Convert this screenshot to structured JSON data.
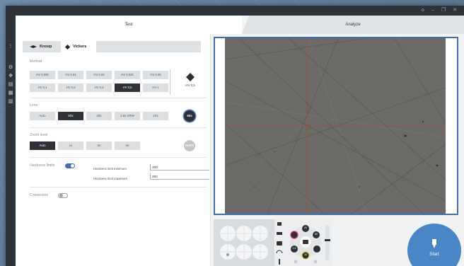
{
  "window": {
    "controls": [
      "ᴑ",
      "–",
      "❐",
      "✕"
    ]
  },
  "tabs": {
    "test": "Test",
    "analyze": "Analyze"
  },
  "method_tabs": {
    "knoop": "Knoop",
    "vickers": "Vickers"
  },
  "method": {
    "label": "Method",
    "buttons": [
      "HV 0,005",
      "HV 0,01",
      "HV 0,02",
      "HV 0,025",
      "HV 0,05",
      "HV 0,1",
      "HV 0,2",
      "HV 0,3",
      "HV 0,5",
      "HV 1"
    ],
    "selected_index": 8,
    "current": "HV 0,5"
  },
  "lens": {
    "label": "Lens",
    "buttons": [
      "Auto",
      "50x",
      "20x",
      "2.5x nRW",
      "10x"
    ],
    "selected_index": 1,
    "current": "50x"
  },
  "zoom": {
    "label": "Zoom level",
    "buttons": [
      "Auto",
      "1x",
      "2x",
      "4x"
    ],
    "selected_index": 0,
    "current": "AUTO"
  },
  "hardness": {
    "label": "Hardness limits",
    "enabled": true,
    "min_label": "Hardness limit minimum",
    "min_value": "200",
    "max_label": "Hardness limit maximum",
    "max_value": "250"
  },
  "conversion": {
    "label": "Conversion",
    "enabled": false
  },
  "dial": {
    "top": "20",
    "right_top": "50",
    "left_bottom": "2.5",
    "bottom": "10"
  },
  "start": {
    "label": "Start"
  },
  "colors": {
    "accent": "#3f6fb0",
    "start_button": "#4a86c6",
    "selected": "#2e3236",
    "crosshair": "#c0392b"
  },
  "icons": {
    "knoop": "knoop-indenter-icon",
    "vickers": "vickers-diamond-icon",
    "start": "indenter-icon"
  }
}
